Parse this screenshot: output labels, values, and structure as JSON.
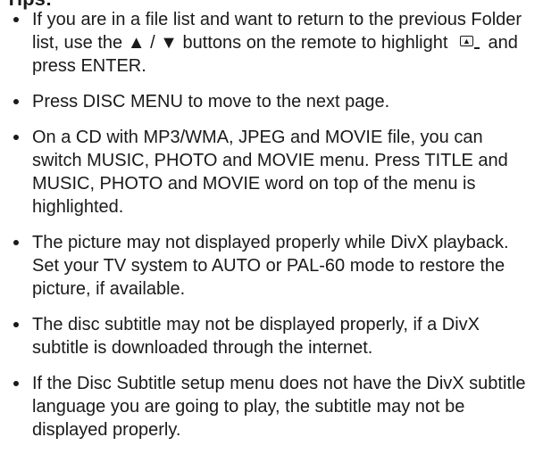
{
  "heading": "Tips:",
  "tips": [
    {
      "before_icon": "If you are in a file list and want to return to the previous Folder list, use the ▲ / ▼ buttons on the remote to highlight",
      "icon": "return-folder-icon",
      "after_icon": "and press ENTER."
    },
    {
      "text": "Press DISC MENU to move to the next page."
    },
    {
      "text": "On a CD with MP3/WMA, JPEG and MOVIE file, you can switch MUSIC, PHOTO and MOVIE menu. Press TITLE and MUSIC, PHOTO and MOVIE word on top of the menu is highlighted."
    },
    {
      "text": "The picture may not displayed properly while DivX playback. Set your TV system to AUTO or PAL-60 mode to restore the picture, if available."
    },
    {
      "text": "The disc subtitle may not be displayed properly, if a DivX subtitle is downloaded through the internet."
    },
    {
      "text": "If the Disc Subtitle setup menu does not have the DivX subtitle language you are going to play, the subtitle may not be displayed properly."
    }
  ]
}
